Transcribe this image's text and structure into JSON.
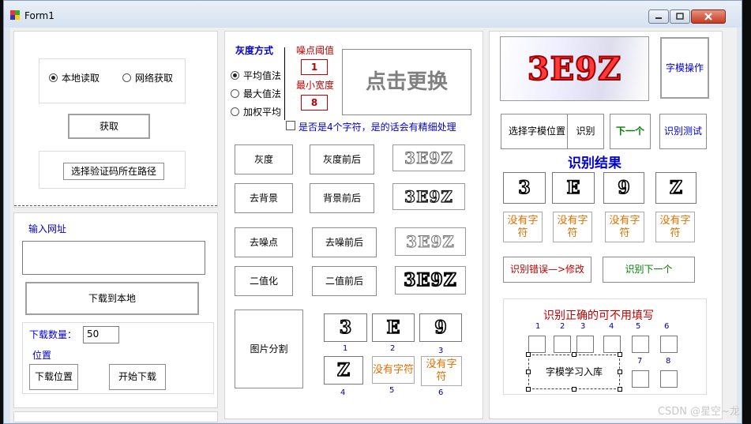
{
  "window": {
    "title": "Form1"
  },
  "left": {
    "radio_local": "本地读取",
    "radio_net": "网络获取",
    "fetch": "获取",
    "select_path": "选择验证码所在路径",
    "url_label": "输入网址",
    "download_local": "下载到本地",
    "count_label": "下载数量：",
    "count_value": "50",
    "pos_label": "位置",
    "download_pos": "下载位置",
    "start_download": "开始下载"
  },
  "middle": {
    "gray_title": "灰度方式",
    "avg": "平均值法",
    "max": "最大值法",
    "weighted": "加权平均",
    "noise_label": "噪点阈值",
    "noise_value": "1",
    "minw_label": "最小宽度",
    "minw_value": "8",
    "refresh": "点击更换",
    "check_label": "是否是4个字符，是的话会有精细处理",
    "btn_gray": "灰度",
    "btn_gray_before": "灰度前后",
    "btn_bg": "去背景",
    "btn_bg_before": "背景前后",
    "btn_noise": "去噪点",
    "btn_noise_before": "去噪前后",
    "btn_bin": "二值化",
    "btn_bin_before": "二值前后",
    "btn_split": "图片分割",
    "captcha": "3E9Z",
    "segments": [
      {
        "num": "1",
        "glyph": "3"
      },
      {
        "num": "2",
        "glyph": "E"
      },
      {
        "num": "3",
        "glyph": "9"
      },
      {
        "num": "4",
        "glyph": "Z"
      },
      {
        "num": "5",
        "text": "没有字符"
      },
      {
        "num": "6",
        "text": "没有字符"
      }
    ]
  },
  "right": {
    "captcha": "3E9Z",
    "template_op": "字模操作",
    "select_template_pos": "选择字模位置",
    "recognize": "识别",
    "next": "下一个",
    "recognize_test": "识别测试",
    "result_title": "识别结果",
    "result_glyphs": [
      "3",
      "E",
      "9",
      "Z"
    ],
    "result_nochars": [
      "没有字符",
      "没有字符",
      "没有字符",
      "没有字符"
    ],
    "wrong_modify": "识别错误—>修改",
    "recognize_next": "识别下一个",
    "correct_hint": "识别正确的可不用填写",
    "slot_nums": [
      "1",
      "2",
      "3",
      "4",
      "5",
      "6",
      "7",
      "8"
    ],
    "learn": "字模学习入库"
  },
  "watermark": "CSDN @星空~龙",
  "colors": {
    "blue": "#0000cc",
    "red": "#c00000",
    "orange": "#e07000",
    "green": "#008000"
  }
}
